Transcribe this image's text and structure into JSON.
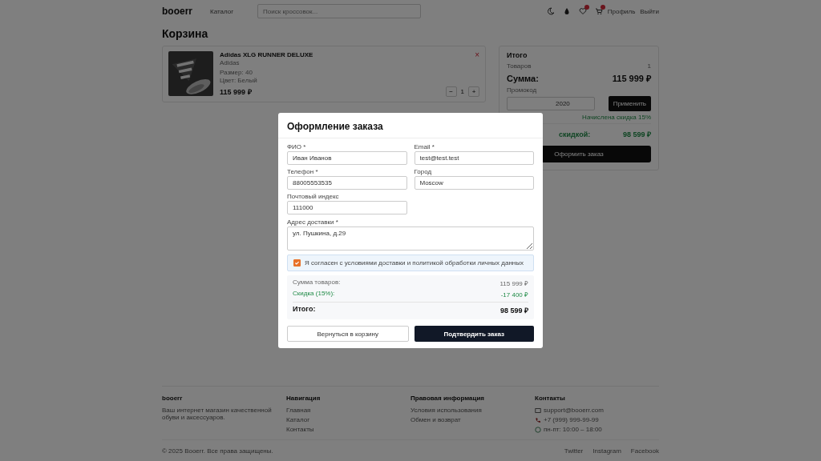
{
  "header": {
    "logo": "booerr",
    "nav": "Каталог",
    "search": {
      "placeholder": "Поиск кроссовок..."
    },
    "profile": "Профиль",
    "logout": "Выйти"
  },
  "page_title": "Корзина",
  "cart_items": [
    {
      "name": "Adidas XLG RUNNER DELUXE",
      "brand": "Adidas",
      "size": "Размер: 40",
      "color_label": "Цвет: Белый",
      "price": "115 999 ₽",
      "remove": "×",
      "minus": "−",
      "quantity": "1",
      "plus": "+"
    }
  ],
  "summary": {
    "title": "Итого",
    "items_label": "Товаров",
    "items_count": "1",
    "sum_label": "Сумма:",
    "sum_value": "115 999 ₽",
    "promo_label": "Промокод",
    "promo_value": "2020",
    "apply": "Применить",
    "promo_note": "Начислена скидка 15%",
    "total_label": "скидкой:",
    "total_value": "98 599 ₽",
    "checkout": "Оформить заказ"
  },
  "modal": {
    "title": "Оформление заказа",
    "fields": [
      {
        "label": "ФИО *",
        "value": "Иван Иванов"
      },
      {
        "label": "Email *",
        "value": "test@test.test"
      },
      {
        "label": "Телефон *",
        "value": "88005553535"
      },
      {
        "label": "Город",
        "value": "Moscow"
      },
      {
        "label": "Почтовый индекс",
        "value": "111000"
      }
    ],
    "address": {
      "label": "Адрес доставки *",
      "value": "ул. Пушкина, д.29"
    },
    "consent": {
      "checked": true,
      "text": "Я согласен с условиями доставки и политикой обработки личных данных"
    },
    "lines": [
      {
        "kind": "normal",
        "label": "Сумма товаров:",
        "value": "115 999 ₽"
      },
      {
        "kind": "discount",
        "label": "Скидка (15%):",
        "value": "-17 400 ₽"
      },
      {
        "kind": "total",
        "label": "Итого:",
        "value": "98 599 ₽"
      }
    ],
    "back": "Вернуться в корзину",
    "confirm": "Подтвердить заказ"
  },
  "footer": {
    "columns": [
      {
        "title": "booerr",
        "items": [
          "Ваш интернет магазин качественной обуви и аксессуаров."
        ]
      },
      {
        "title": "Навигация",
        "items": [
          "Главная",
          "Каталог",
          "Контакты"
        ]
      },
      {
        "title": "Правовая информация",
        "items": [
          "Условия использования",
          "Обмен и возврат"
        ]
      },
      {
        "title": "Контакты",
        "items": [
          "support@booerr.com",
          "+7 (999) 999-99-99",
          "пн-пт: 10:00 – 18:00"
        ]
      }
    ],
    "copyright": "© 2025 Booerr. Все права защищены.",
    "social": [
      "Twitter",
      "Instagram",
      "Facebook"
    ]
  }
}
